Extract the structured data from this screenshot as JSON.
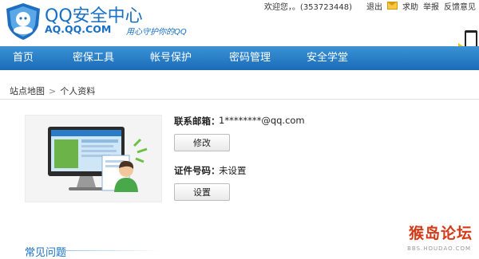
{
  "header": {
    "title": "QQ安全中心",
    "url": "AQ.QQ.COM",
    "slogan": "用心守护你的QQ",
    "greeting": "欢迎您，。(353723448)",
    "links": {
      "logout": "退出",
      "help": "求助",
      "report": "举报",
      "feedback": "反馈意见"
    }
  },
  "nav": {
    "items": [
      {
        "label": "首页"
      },
      {
        "label": "密保工具"
      },
      {
        "label": "帐号保护"
      },
      {
        "label": "密码管理"
      },
      {
        "label": "安全学堂"
      }
    ]
  },
  "breadcrumb": {
    "home": "站点地图",
    "current": "个人资料"
  },
  "profile": {
    "email_label": "联系邮箱：",
    "email_value": "1********@qq.com",
    "modify_button": "修改",
    "id_label": "证件号码：",
    "id_value": "未设置",
    "set_button": "设置"
  },
  "faq": {
    "title": "常见问题"
  },
  "watermark": {
    "text": "猴岛论坛",
    "sub": "BBS.HOUDAO.COM"
  },
  "colors": {
    "brand": "#1870c4",
    "nav": "#2a7ec8",
    "watermark": "#d43a17"
  }
}
